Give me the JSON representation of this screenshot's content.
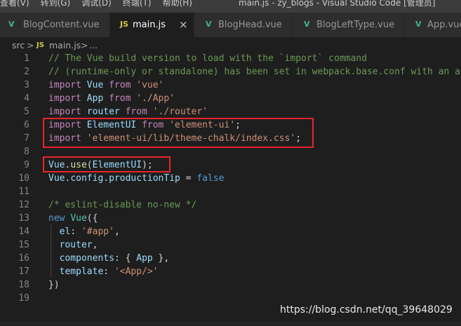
{
  "menubar": {
    "items": [
      "查看(V)",
      "转到(G)",
      "调试(D)",
      "终端(T)",
      "帮助(H)"
    ],
    "title": "main.js - zy_blogs - Visual Studio Code [管理员]"
  },
  "tabs": [
    {
      "icon": "V",
      "label": "BlogContent.vue"
    },
    {
      "icon": "JS",
      "label": "main.js",
      "close": "×"
    },
    {
      "icon": "V",
      "label": "BlogHead.vue"
    },
    {
      "icon": "V",
      "label": "BlogLeftType.vue"
    },
    {
      "icon": "V",
      "label": "App.vue"
    }
  ],
  "breadcrumb": {
    "folder": "src",
    "sep1": ">",
    "icon": "JS",
    "file": "main.js",
    "sep2": ">",
    "more": "..."
  },
  "editor": {
    "lines": [
      {
        "num": "1",
        "tokens": [
          {
            "t": "// The Vue build version to load with the `import` command",
            "c": "c"
          }
        ]
      },
      {
        "num": "2",
        "tokens": [
          {
            "t": "// (runtime-only or standalone) has been set in webpack.base.conf with an ali",
            "c": "c"
          }
        ]
      },
      {
        "num": "3",
        "tokens": [
          {
            "t": "import",
            "c": "k"
          },
          {
            "t": " ",
            "c": "p"
          },
          {
            "t": "Vue",
            "c": "v"
          },
          {
            "t": " ",
            "c": "p"
          },
          {
            "t": "from",
            "c": "k"
          },
          {
            "t": " ",
            "c": "p"
          },
          {
            "t": "'vue'",
            "c": "s"
          }
        ]
      },
      {
        "num": "4",
        "tokens": [
          {
            "t": "import",
            "c": "k"
          },
          {
            "t": " ",
            "c": "p"
          },
          {
            "t": "App",
            "c": "v"
          },
          {
            "t": " ",
            "c": "p"
          },
          {
            "t": "from",
            "c": "k"
          },
          {
            "t": " ",
            "c": "p"
          },
          {
            "t": "'./App'",
            "c": "s"
          }
        ]
      },
      {
        "num": "5",
        "tokens": [
          {
            "t": "import",
            "c": "k"
          },
          {
            "t": " ",
            "c": "p"
          },
          {
            "t": "router",
            "c": "v"
          },
          {
            "t": " ",
            "c": "p"
          },
          {
            "t": "from",
            "c": "k"
          },
          {
            "t": " ",
            "c": "p"
          },
          {
            "t": "'./router'",
            "c": "s"
          }
        ]
      },
      {
        "num": "6",
        "tokens": [
          {
            "t": "import",
            "c": "k"
          },
          {
            "t": " ",
            "c": "p"
          },
          {
            "t": "ElementUI",
            "c": "v"
          },
          {
            "t": " ",
            "c": "p"
          },
          {
            "t": "from",
            "c": "k"
          },
          {
            "t": " ",
            "c": "p"
          },
          {
            "t": "'element-ui'",
            "c": "s"
          },
          {
            "t": ";",
            "c": "p"
          }
        ]
      },
      {
        "num": "7",
        "tokens": [
          {
            "t": "import",
            "c": "k"
          },
          {
            "t": " ",
            "c": "p"
          },
          {
            "t": "'element-ui/lib/theme-chalk/index.css'",
            "c": "s"
          },
          {
            "t": ";",
            "c": "p"
          }
        ]
      },
      {
        "num": "8",
        "tokens": []
      },
      {
        "num": "9",
        "tokens": [
          {
            "t": "Vue",
            "c": "v"
          },
          {
            "t": ".",
            "c": "p"
          },
          {
            "t": "use",
            "c": "f"
          },
          {
            "t": "(",
            "c": "p"
          },
          {
            "t": "ElementUI",
            "c": "v"
          },
          {
            "t": ");",
            "c": "p"
          }
        ]
      },
      {
        "num": "10",
        "tokens": [
          {
            "t": "Vue",
            "c": "v"
          },
          {
            "t": ".",
            "c": "p"
          },
          {
            "t": "config",
            "c": "v"
          },
          {
            "t": ".",
            "c": "p"
          },
          {
            "t": "productionTip",
            "c": "v"
          },
          {
            "t": " = ",
            "c": "p"
          },
          {
            "t": "false",
            "c": "b"
          }
        ]
      },
      {
        "num": "11",
        "tokens": []
      },
      {
        "num": "12",
        "tokens": [
          {
            "t": "/* eslint-disable no-new */",
            "c": "c"
          }
        ]
      },
      {
        "num": "13",
        "tokens": [
          {
            "t": "new",
            "c": "b"
          },
          {
            "t": " ",
            "c": "p"
          },
          {
            "t": "Vue",
            "c": "t"
          },
          {
            "t": "({",
            "c": "p"
          }
        ]
      },
      {
        "num": "14",
        "tokens": [
          {
            "t": "  ",
            "c": "p"
          },
          {
            "t": "el",
            "c": "v"
          },
          {
            "t": ": ",
            "c": "p"
          },
          {
            "t": "'#app'",
            "c": "s"
          },
          {
            "t": ",",
            "c": "p"
          }
        ]
      },
      {
        "num": "15",
        "tokens": [
          {
            "t": "  ",
            "c": "p"
          },
          {
            "t": "router",
            "c": "v"
          },
          {
            "t": ",",
            "c": "p"
          }
        ]
      },
      {
        "num": "16",
        "tokens": [
          {
            "t": "  ",
            "c": "p"
          },
          {
            "t": "components",
            "c": "v"
          },
          {
            "t": ": { ",
            "c": "p"
          },
          {
            "t": "App",
            "c": "v"
          },
          {
            "t": " },",
            "c": "p"
          }
        ]
      },
      {
        "num": "17",
        "tokens": [
          {
            "t": "  ",
            "c": "p"
          },
          {
            "t": "template",
            "c": "v"
          },
          {
            "t": ": ",
            "c": "p"
          },
          {
            "t": "'<App/>'",
            "c": "s"
          }
        ]
      },
      {
        "num": "18",
        "tokens": [
          {
            "t": "})",
            "c": "p"
          }
        ]
      },
      {
        "num": "19",
        "tokens": []
      }
    ]
  },
  "watermark": "https://blog.csdn.net/qq_39648029",
  "colors": {
    "highlight_border": "#e8252a",
    "editor_bg": "#1e1e1e",
    "vue_icon": "#41b883",
    "js_icon": "#cbcb41"
  }
}
